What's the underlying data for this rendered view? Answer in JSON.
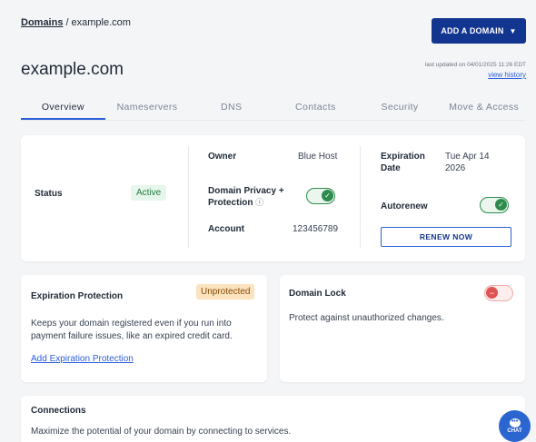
{
  "breadcrumb": {
    "root": "Domains",
    "separator": "/",
    "current": "example.com"
  },
  "header": {
    "title": "example.com",
    "add_button": "ADD A DOMAIN",
    "last_updated": "last updated on 04/01/2025 11:26 EDT",
    "history_link": "view history"
  },
  "tabs": [
    {
      "label": "Overview",
      "active": true
    },
    {
      "label": "Nameservers",
      "active": false
    },
    {
      "label": "DNS",
      "active": false
    },
    {
      "label": "Contacts",
      "active": false
    },
    {
      "label": "Security",
      "active": false
    },
    {
      "label": "Move & Access",
      "active": false
    }
  ],
  "status": {
    "label": "Status",
    "value": "Active",
    "owner_label": "Owner",
    "owner_value": "Blue Host",
    "privacy_label_line1": "Domain Privacy +",
    "privacy_label_line2": "Protection",
    "privacy_info_icon": "info-icon",
    "privacy_enabled": true,
    "account_label": "Account",
    "account_value": "123456789",
    "expiration_label_line1": "Expiration",
    "expiration_label_line2": "Date",
    "expiration_value_line1": "Tue Apr 14",
    "expiration_value_line2": "2026",
    "autorenew_label": "Autorenew",
    "autorenew_enabled": true,
    "renew_button": "RENEW NOW"
  },
  "expiration_protection": {
    "title": "Expiration Protection",
    "badge": "Unprotected",
    "desc_line1": "Keeps your domain registered even if you run into",
    "desc_line2": "payment failure issues, like an expired credit card.",
    "link": "Add Expiration Protection"
  },
  "domain_lock": {
    "title": "Domain Lock",
    "enabled": false,
    "desc": "Protect against unauthorized changes."
  },
  "connections": {
    "title": "Connections",
    "desc": "Maximize the potential of your domain by connecting to services."
  },
  "chat": {
    "label": "CHAT",
    "icon": "chat-bubble-icon"
  },
  "colors": {
    "primary": "#12358f",
    "link": "#2b5fd9",
    "success": "#2e8b4e",
    "danger": "#e05353",
    "warning_bg": "#fbe3bf"
  }
}
